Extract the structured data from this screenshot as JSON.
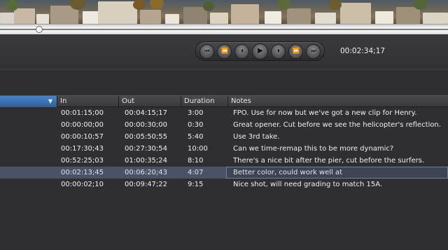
{
  "transport": {
    "buttons": [
      {
        "name": "go-to-start",
        "glyph": "⏮"
      },
      {
        "name": "rewind",
        "glyph": "⏪"
      },
      {
        "name": "step-back",
        "glyph": "⏴"
      },
      {
        "name": "play",
        "glyph": "▶"
      },
      {
        "name": "step-forward",
        "glyph": "⏵"
      },
      {
        "name": "fast-forward",
        "glyph": "⏩"
      },
      {
        "name": "go-to-end",
        "glyph": "⏭"
      }
    ],
    "timecode": "00:02:34;17"
  },
  "table": {
    "headers": {
      "in": "In",
      "out": "Out",
      "duration": "Duration",
      "notes": "Notes"
    },
    "sort_indicator": "▼",
    "rows": [
      {
        "in": "00:01:15;00",
        "out": "00:04:15;17",
        "duration": "3:00",
        "notes": "FPO. Use for now but we've got a new clip for Henry."
      },
      {
        "in": "00:00:00;00",
        "out": "00:00:30;00",
        "duration": "0:30",
        "notes": "Great opener. Cut before we see the helicopter's reflection."
      },
      {
        "in": "00:00:10;57",
        "out": "00:05:50;55",
        "duration": "5:40",
        "notes": "Use 3rd take."
      },
      {
        "in": "00:17:30;43",
        "out": "00:27:30;54",
        "duration": "10:00",
        "notes": "Can we time-remap this to be more dynamic?"
      },
      {
        "in": "00:52:25;03",
        "out": "01:00:35;24",
        "duration": "8:10",
        "notes": "There's a nice bit after the pier, cut before the surfers."
      },
      {
        "in": "00:02:13;45",
        "out": "00:06:20;43",
        "duration": "4:07",
        "notes": "Better color, could work well at",
        "selected": true
      },
      {
        "in": "00:00:02;10",
        "out": "00:09:47;22",
        "duration": "9:15",
        "notes": "Nice shot, will need grading to match 15A."
      }
    ]
  }
}
